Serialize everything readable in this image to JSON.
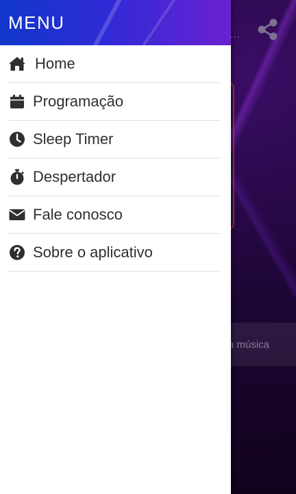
{
  "drawer": {
    "title": "MENU",
    "items": [
      {
        "label": "Home",
        "icon": "home-icon"
      },
      {
        "label": "Programação",
        "icon": "calendar-icon"
      },
      {
        "label": "Sleep Timer",
        "icon": "clock-icon"
      },
      {
        "label": "Despertador",
        "icon": "stopwatch-icon"
      },
      {
        "label": "Fale conosco",
        "icon": "envelope-icon"
      },
      {
        "label": "Sobre o aplicativo",
        "icon": "question-icon"
      }
    ]
  },
  "background": {
    "overflow_text": "...",
    "song_text": "a música",
    "share_icon": "share-icon"
  },
  "colors": {
    "header_start": "#1037c9",
    "header_end": "#6a22cf",
    "text": "#2f2f2f"
  }
}
